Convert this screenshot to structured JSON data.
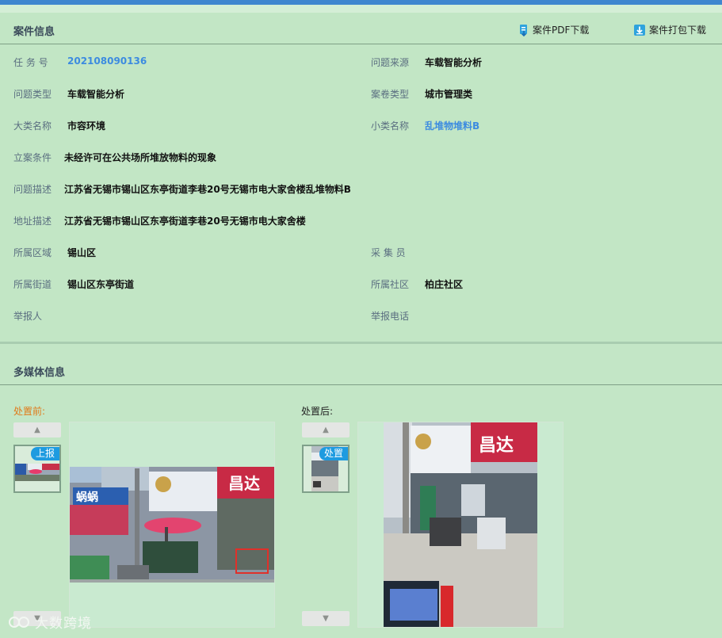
{
  "case_section": {
    "title": "案件信息",
    "pdf_download": "案件PDF下载",
    "pack_download": "案件打包下载",
    "fields": {
      "task_no": {
        "label": "任 务 号",
        "value": "202108090136"
      },
      "problem_source": {
        "label": "问题来源",
        "value": "车载智能分析"
      },
      "problem_type": {
        "label": "问题类型",
        "value": "车载智能分析"
      },
      "case_type": {
        "label": "案卷类型",
        "value": "城市管理类"
      },
      "major_category": {
        "label": "大类名称",
        "value": "市容环境"
      },
      "minor_category": {
        "label": "小类名称",
        "value": "乱堆物堆料B"
      },
      "filing_condition": {
        "label": "立案条件",
        "value": "未经许可在公共场所堆放物料的现象"
      },
      "problem_desc": {
        "label": "问题描述",
        "value": "江苏省无锡市锡山区东亭街道李巷20号无锡市电大家舍楼乱堆物料B"
      },
      "address_desc": {
        "label": "地址描述",
        "value": "江苏省无锡市锡山区东亭街道李巷20号无锡市电大家舍楼"
      },
      "district": {
        "label": "所属区域",
        "value": "锡山区"
      },
      "collector": {
        "label": "采 集 员",
        "value": ""
      },
      "street": {
        "label": "所属街道",
        "value": "锡山区东亭街道"
      },
      "community": {
        "label": "所属社区",
        "value": "柏庄社区"
      },
      "reporter": {
        "label": "举报人",
        "value": ""
      },
      "report_phone": {
        "label": "举报电话",
        "value": ""
      }
    }
  },
  "media_section": {
    "title": "多媒体信息",
    "before": {
      "label": "处置前:",
      "badge": "上报",
      "sign_left": "蜗蜗",
      "sign_right": "昌达"
    },
    "after": {
      "label": "处置后:",
      "badge": "处置",
      "sign_right": "昌达"
    }
  },
  "watermark": "大数跨境",
  "colors": {
    "accent": "#3f86cf",
    "link": "#3c8be0",
    "badge": "#1e9be0",
    "before_label": "#e07a1a"
  }
}
